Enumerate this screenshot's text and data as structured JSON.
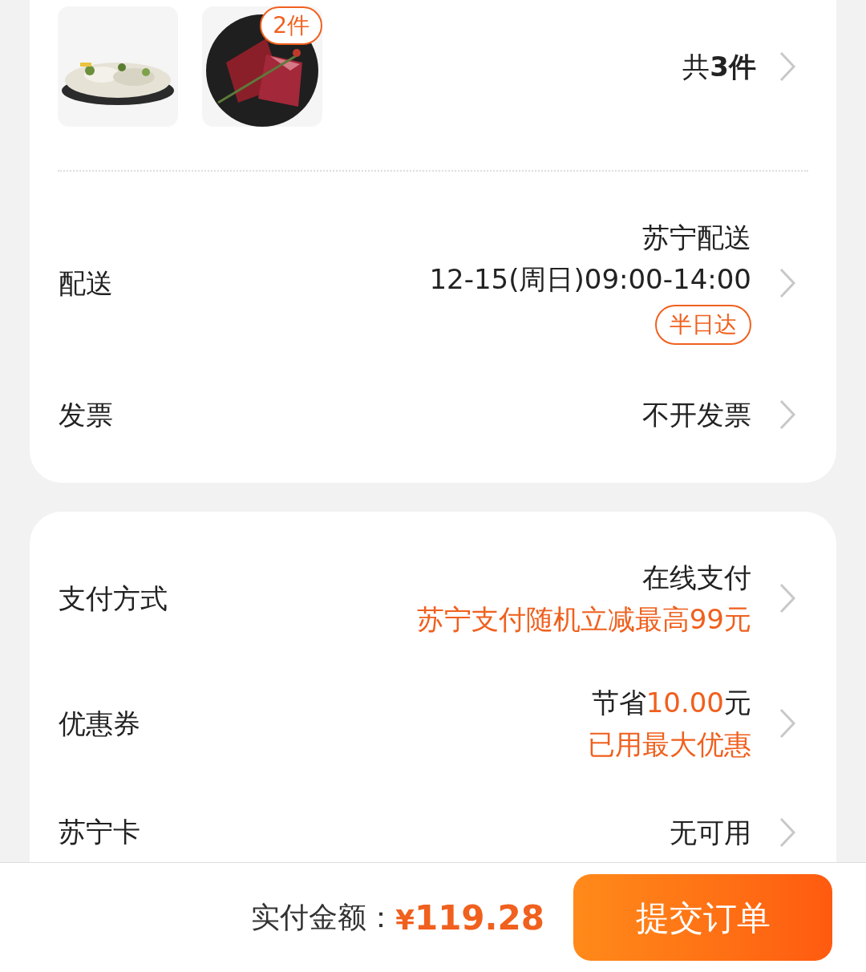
{
  "items_card": {
    "thumbnails": [
      {
        "kind": "picture"
      },
      {
        "kind": "picture",
        "badge": "2件"
      }
    ],
    "total": "共**3件**"
  },
  "delivery_rows": [
    {
      "label": "配送",
      "lines": [
        [
          {
            "text": "苏宁配送",
            "accent": false
          }
        ],
        [
          {
            "text": "12-15(周日)09:00-14:00",
            "accent": false
          }
        ]
      ],
      "tag": "半日达"
    },
    {
      "label": "发票",
      "lines": [
        [
          {
            "text": "不开发票",
            "accent": false
          }
        ]
      ]
    }
  ],
  "payment_rows": [
    {
      "label": "支付方式",
      "lines": [
        [
          {
            "text": "在线支付",
            "accent": false
          }
        ],
        [
          {
            "text": "苏宁支付随机立减最高99元",
            "accent": true
          }
        ]
      ]
    },
    {
      "label": "优惠券",
      "lines": [
        [
          {
            "text": "节省",
            "accent": false
          },
          {
            "text": "10.00",
            "accent": true
          },
          {
            "text": "元",
            "accent": false
          }
        ],
        [
          {
            "text": "已用最大优惠",
            "accent": true
          }
        ]
      ]
    },
    {
      "label": "苏宁卡",
      "lines": [
        [
          {
            "text": "无可用",
            "accent": false
          }
        ]
      ]
    }
  ],
  "footer": {
    "total_label": "实付金额：",
    "currency": "¥",
    "amount": "119.28",
    "submit_button": "提交订单"
  }
}
